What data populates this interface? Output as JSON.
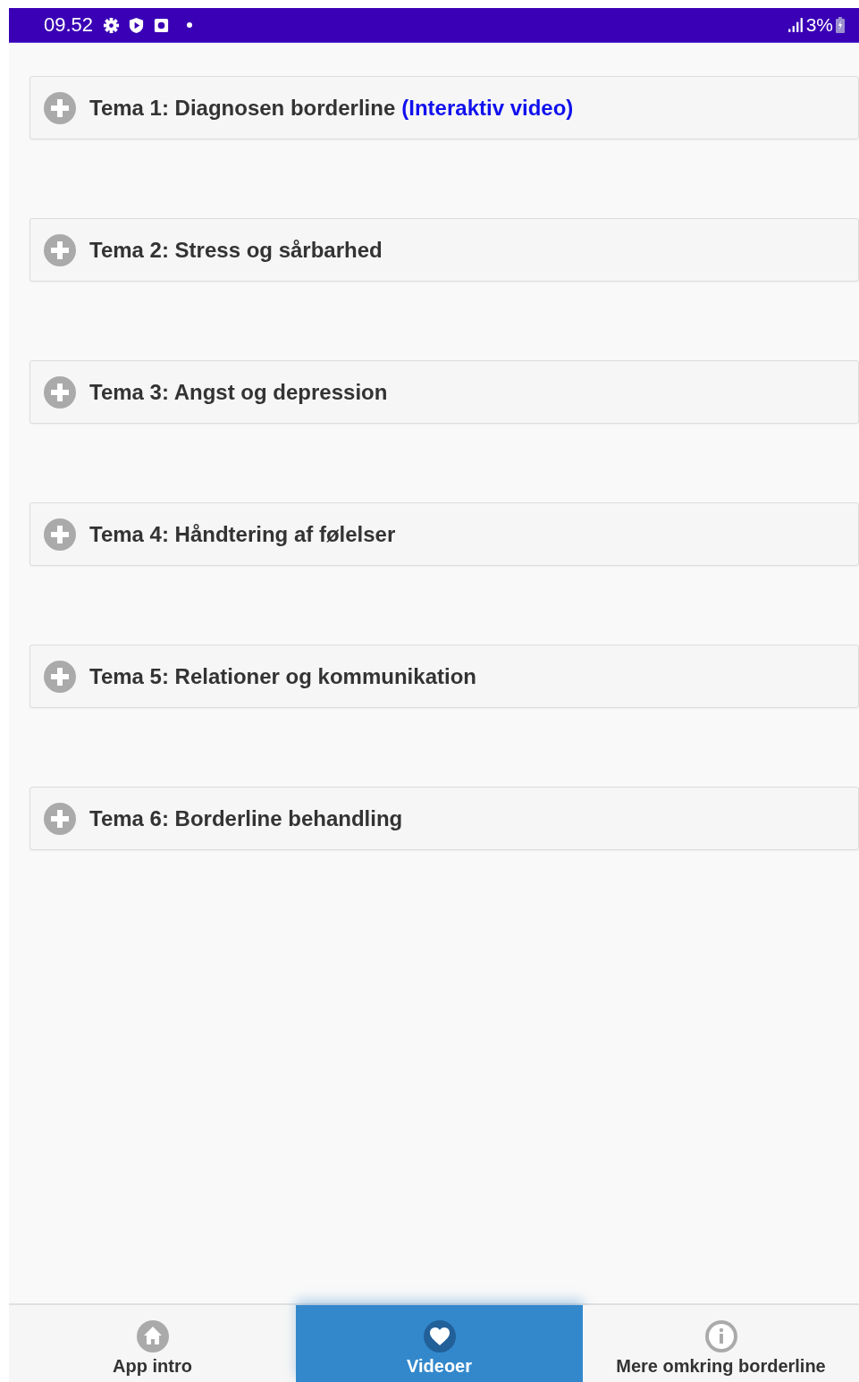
{
  "status_bar": {
    "time": "09.52",
    "battery": "3%"
  },
  "topics": [
    {
      "title": "Tema 1: Diagnosen borderline",
      "link": "(Interaktiv video)",
      "expanded": false
    },
    {
      "title": "Tema 2: Stress og sårbarhed",
      "expanded": false
    },
    {
      "title": "Tema 3: Angst og depression",
      "expanded": false
    },
    {
      "title": "Tema 4: Håndtering af følelser",
      "expanded": false
    },
    {
      "title": "Tema 5: Relationer og kommunikation",
      "expanded": false
    },
    {
      "title": "Tema 6: Borderline behandling",
      "expanded": false
    }
  ],
  "bottom_nav": [
    {
      "label": "App intro",
      "kind": "home",
      "selected": false
    },
    {
      "label": "Videoer",
      "kind": "heart",
      "selected": true
    },
    {
      "label": "Mere omkring borderline",
      "kind": "info",
      "selected": false
    }
  ]
}
